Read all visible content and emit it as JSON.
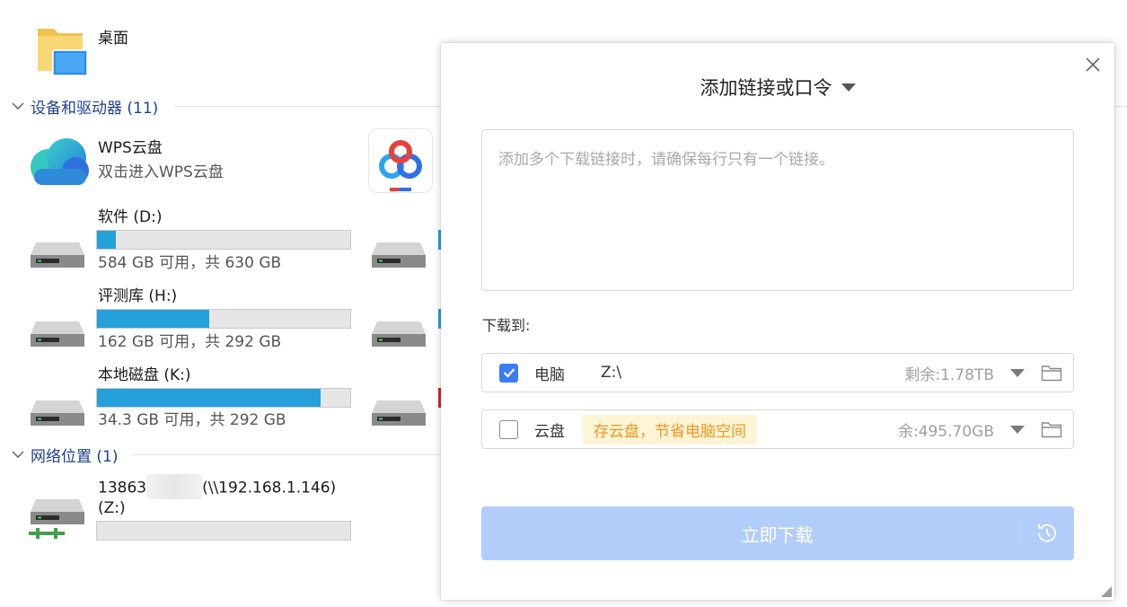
{
  "explorer": {
    "desktop": {
      "label": "桌面"
    },
    "devices_section": {
      "title": "设备和驱动器 (11)"
    },
    "wps": {
      "name": "WPS云盘",
      "desc": "双击进入WPS云盘"
    },
    "drives": [
      {
        "name": "软件 (D:)",
        "space": "584 GB 可用，共 630 GB",
        "used_fraction": 0.073
      },
      {
        "name": "评测库 (H:)",
        "space": "162 GB 可用，共 292 GB",
        "used_fraction": 0.445
      },
      {
        "name": "本地磁盘 (K:)",
        "space": "34.3 GB 可用，共 292 GB",
        "used_fraction": 0.882
      }
    ],
    "network_section": {
      "title": "网络位置 (1)"
    },
    "network_drive": {
      "name_prefix": "13863",
      "name_suffix": "(\\\\192.168.1.146)",
      "letter": "(Z:)",
      "used_fraction": 0
    }
  },
  "dialog": {
    "title": "添加链接或口令",
    "link_input": {
      "placeholder": "添加多个下载链接时，请确保每行只有一个链接。",
      "value": ""
    },
    "download_to_label": "下载到:",
    "options": [
      {
        "label": "电脑",
        "checked": true,
        "path": "Z:\\",
        "remaining": "剩余:1.78TB"
      },
      {
        "label": "云盘",
        "checked": false,
        "tip": "存云盘，节省电脑空间",
        "remaining": "余:495.70GB"
      }
    ],
    "download_button": "立即下载",
    "colors": {
      "accent": "#3b7cf5",
      "button_disabled": "#b3cdfb",
      "tip_bg": "#fff4d6",
      "tip_text": "#f0961e",
      "section_link": "#1e3f8f",
      "drive_fill": "#26a0da"
    }
  }
}
